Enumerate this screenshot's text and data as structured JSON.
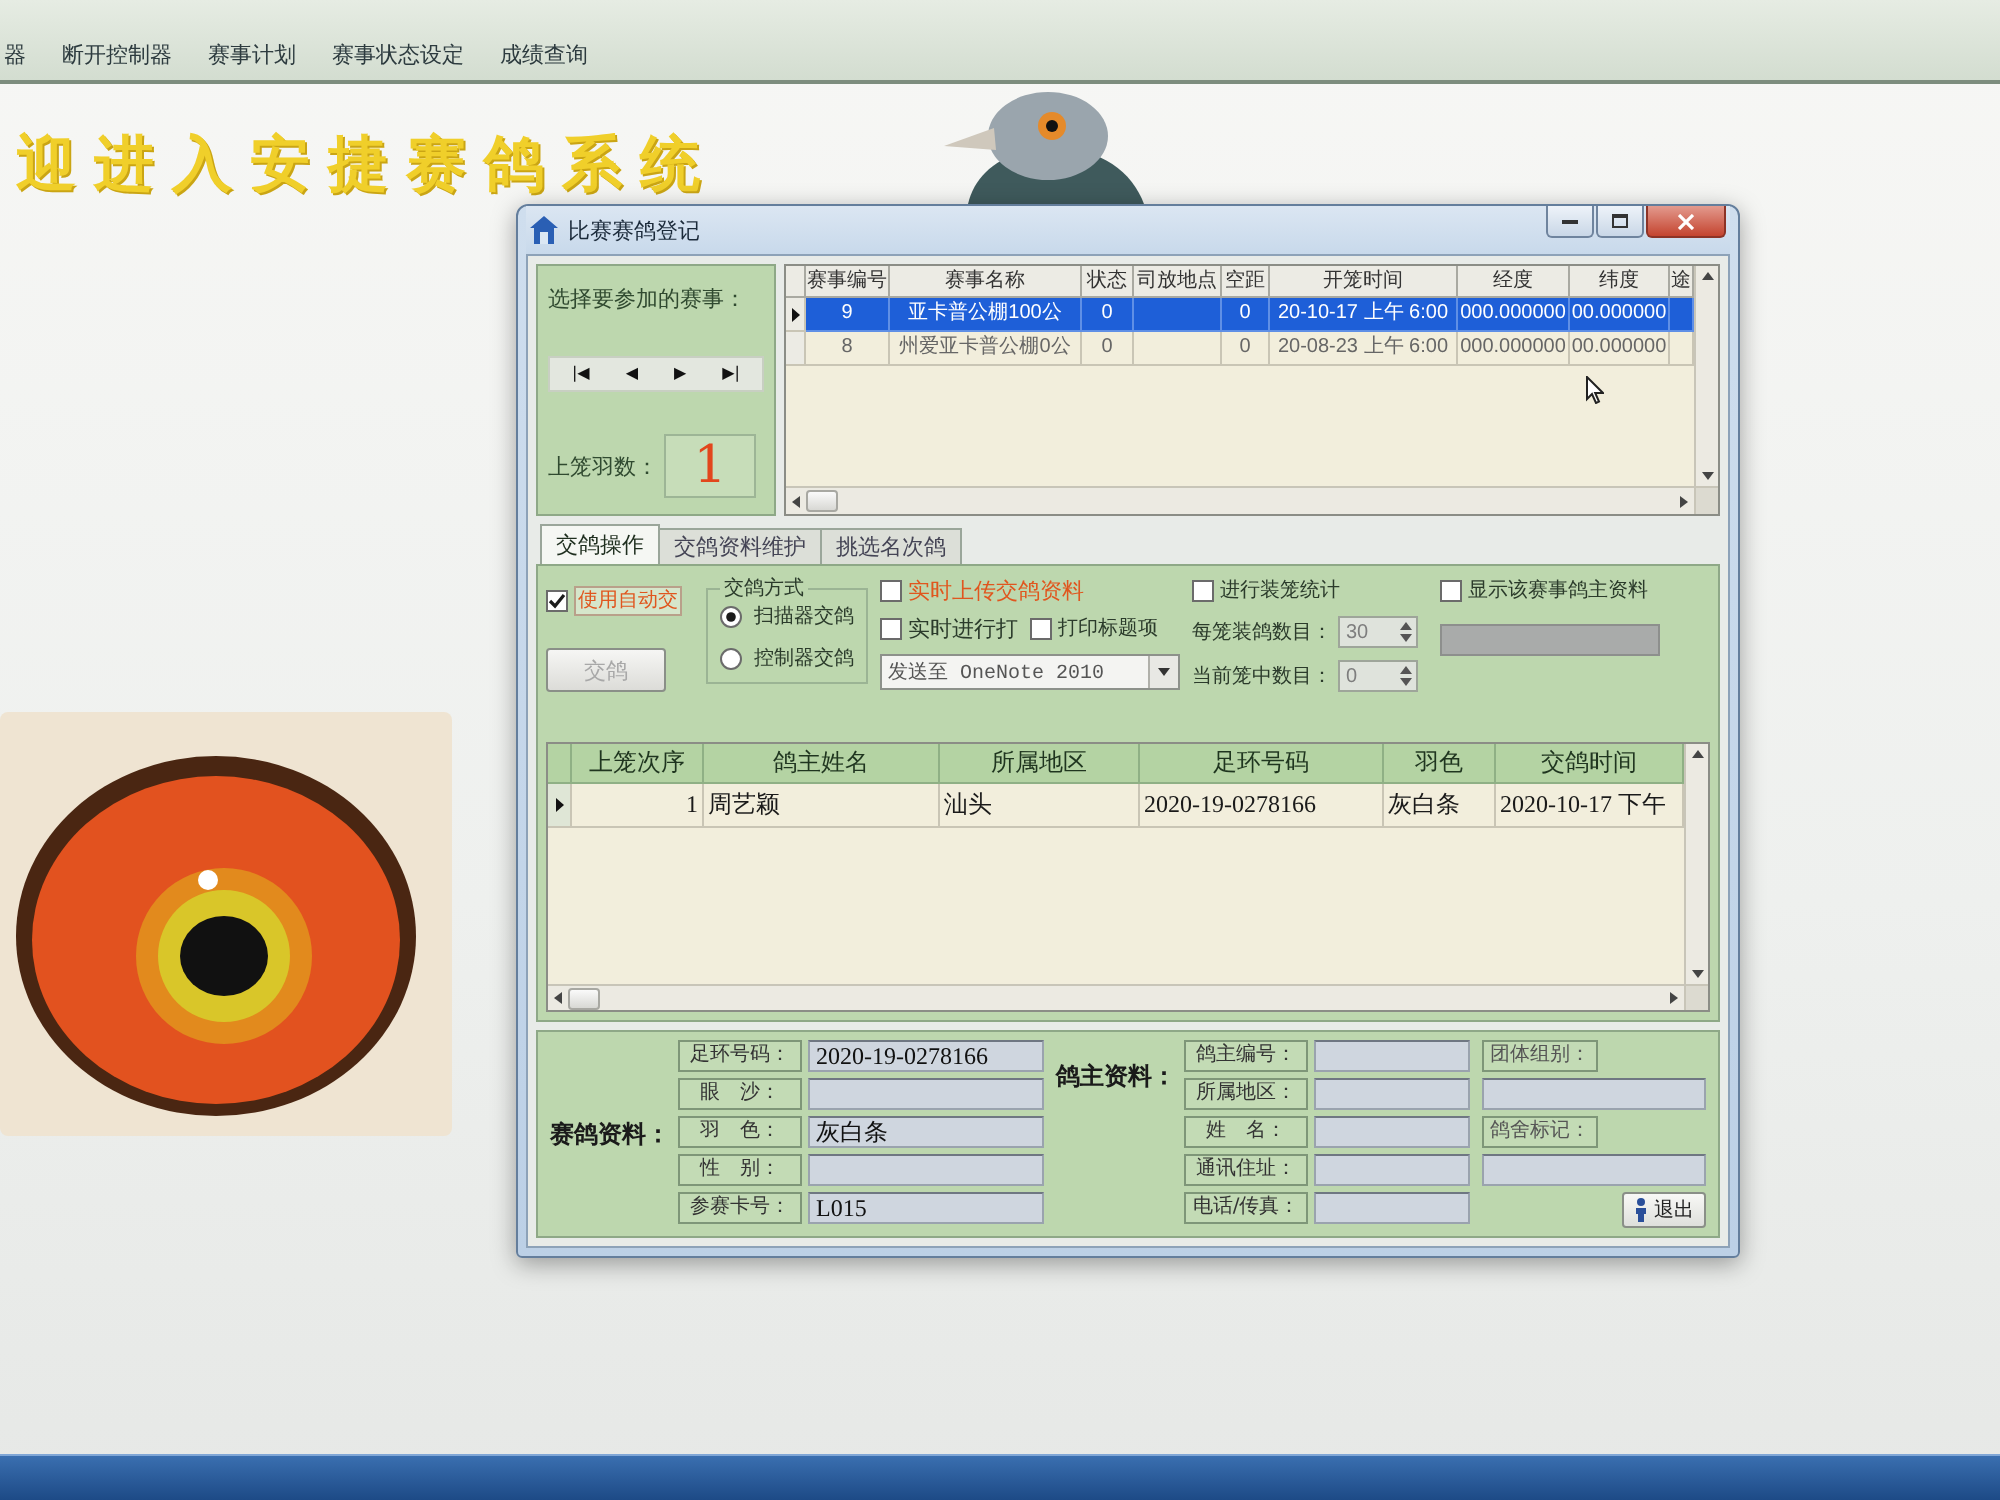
{
  "toolbar": {
    "items": [
      {
        "label": "器"
      },
      {
        "label": "断开控制器"
      },
      {
        "label": "赛事计划"
      },
      {
        "label": "赛事状态设定"
      },
      {
        "label": "成绩查询"
      }
    ]
  },
  "welcome": "迎进入安捷赛鸽系统",
  "dialog": {
    "title": "比赛赛鸽登记",
    "race_picker": {
      "prompt": "选择要参加的赛事：",
      "nav": [
        "|◀",
        "◀",
        "▶",
        "▶|"
      ],
      "count_label": "上笼羽数：",
      "count": "1"
    },
    "races": {
      "columns": [
        "赛事编号",
        "赛事名称",
        "状态",
        "司放地点",
        "空距",
        "开笼时间",
        "经度",
        "纬度",
        "途"
      ],
      "rows": [
        {
          "selected": true,
          "cells": [
            "9",
            "亚卡普公棚100公",
            "0",
            null,
            "0",
            "20-10-17 上午 6:00",
            "000.000000",
            "00.000000"
          ]
        },
        {
          "selected": false,
          "cells": [
            "8",
            "州爱亚卡普公棚0公",
            "0",
            null,
            "0",
            "20-08-23 上午 6:00",
            "000.000000",
            "00.000000"
          ]
        }
      ]
    },
    "tabs": [
      {
        "label": "交鸽操作",
        "selected": true
      },
      {
        "label": "交鸽资料维护",
        "selected": false
      },
      {
        "label": "挑选名次鸽",
        "selected": false
      }
    ],
    "options": {
      "auto": {
        "label": "使用自动交",
        "checked": true
      },
      "submit_button": {
        "label": "交鸽",
        "disabled": true
      },
      "method": {
        "title": "交鸽方式",
        "options": [
          {
            "label": "扫描器交鸽",
            "selected": true
          },
          {
            "label": "控制器交鸽",
            "selected": false
          }
        ]
      },
      "upload": {
        "label": "实时上传交鸽资料",
        "checked": false
      },
      "print": {
        "label": "实时进行打",
        "checked": false
      },
      "print_title": {
        "label": "打印标题项",
        "checked": false
      },
      "printer": {
        "value": "发送至 OneNote 2010"
      },
      "cage_stats": {
        "label": "进行装笼统计",
        "checked": false
      },
      "counters": [
        {
          "label": "每笼装鸽数目：",
          "value": "30",
          "disabled": true
        },
        {
          "label": "当前笼中数目：",
          "value": "0",
          "disabled": true
        }
      ],
      "show_owner": {
        "label": "显示该赛事鸽主资料",
        "checked": false
      }
    },
    "entries": {
      "columns": [
        "上笼次序",
        "鸽主姓名",
        "所属地区",
        "足环号码",
        "羽色",
        "交鸽时间"
      ],
      "rows": [
        {
          "selected": true,
          "cells": [
            "1",
            "周艺颖",
            "汕头",
            "2020-19-0278166",
            "灰白条",
            "2020-10-17 下午"
          ]
        }
      ]
    },
    "pigeon_info": {
      "title": "赛鸽资料：",
      "fields": [
        {
          "label": "足环号码：",
          "value": "2020-19-0278166"
        },
        {
          "label": "眼　沙："
        },
        {
          "label": "羽　色：",
          "value": "灰白条"
        },
        {
          "label": "性　别："
        },
        {
          "label": "参赛卡号：",
          "value": "L015"
        }
      ]
    },
    "owner_info": {
      "title": "鸽主资料：",
      "fields": [
        {
          "label": "鸽主编号："
        },
        {
          "label": "所属地区："
        },
        {
          "label": "姓　名："
        },
        {
          "label": "通讯住址："
        },
        {
          "label": "电话/传真："
        }
      ]
    },
    "notes": [
      {
        "label": "团体组别："
      },
      {
        "label": "鸽舍标记："
      }
    ],
    "exit_button": {
      "label": "退出"
    }
  }
}
